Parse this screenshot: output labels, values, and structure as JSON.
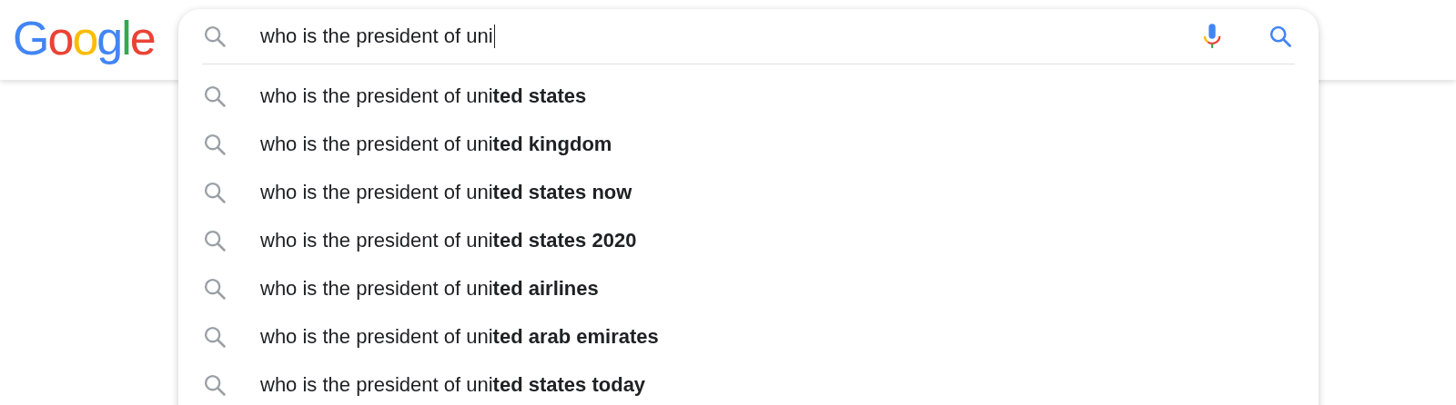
{
  "logo": "Google",
  "search": {
    "value": "who is the president of uni",
    "focused": true
  },
  "suggestions": [
    {
      "text": "who is the president of uni**ted states**"
    },
    {
      "text": "who is the president of uni**ted kingdom**"
    },
    {
      "text": "who is the president of uni**ted states now**"
    },
    {
      "text": "who is the president of uni**ted states 2020**"
    },
    {
      "text": "who is the president of uni**ted airlines**"
    },
    {
      "text": "who is the president of uni**ted arab emirates**"
    },
    {
      "text": "who is the president of uni**ted states today**"
    }
  ]
}
